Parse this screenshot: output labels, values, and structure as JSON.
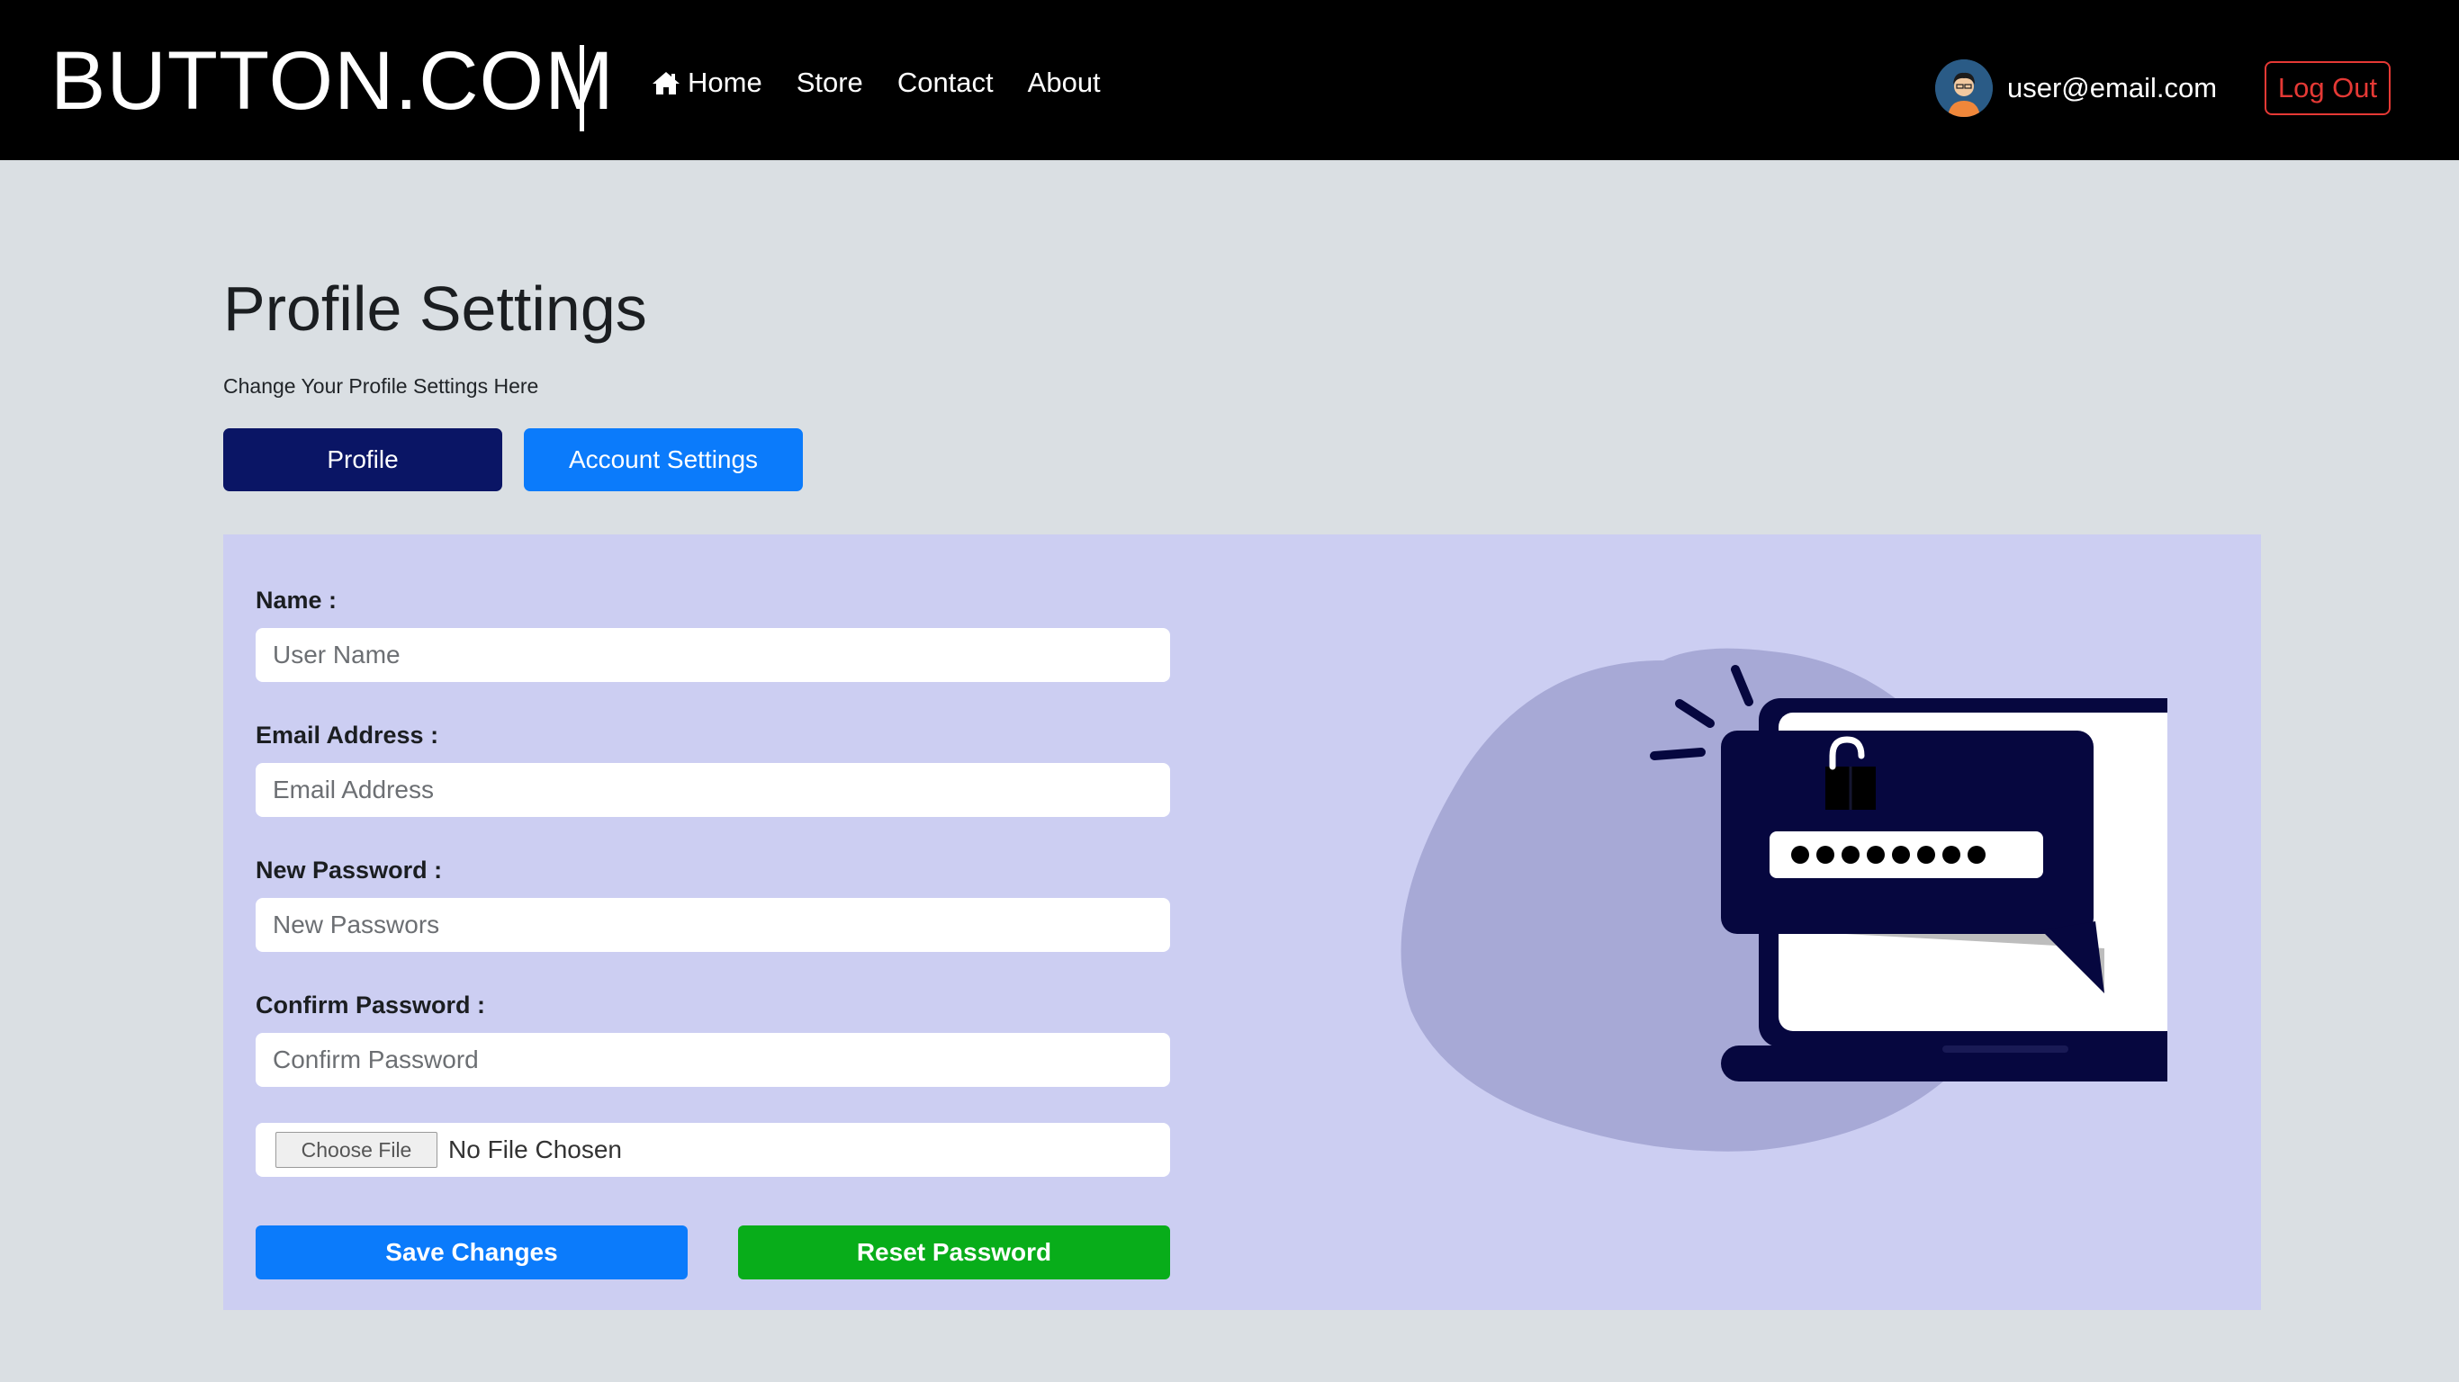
{
  "header": {
    "brand": "BUTTON.COM",
    "nav": [
      {
        "label": "Home",
        "icon": "home-icon"
      },
      {
        "label": "Store"
      },
      {
        "label": "Contact"
      },
      {
        "label": "About"
      }
    ],
    "user_email": "user@email.com",
    "logout_label": "Log Out"
  },
  "page": {
    "title": "Profile Settings",
    "subtitle": "Change Your Profile Settings Here",
    "tabs": [
      {
        "label": "Profile",
        "active": true
      },
      {
        "label": "Account Settings",
        "active": false
      }
    ]
  },
  "form": {
    "name": {
      "label": "Name :",
      "placeholder": "User Name",
      "value": ""
    },
    "email": {
      "label": "Email Address :",
      "placeholder": "Email Address",
      "value": ""
    },
    "new_password": {
      "label": "New Password :",
      "placeholder": "New Passwors",
      "value": ""
    },
    "confirm_password": {
      "label": "Confirm Password :",
      "placeholder": "Confirm Password",
      "value": ""
    },
    "file": {
      "button_label": "Choose File",
      "status": "No File Chosen"
    },
    "save_label": "Save Changes",
    "reset_label": "Reset Password"
  },
  "illustration": {
    "icon": "password-laptop-illustration",
    "masked_password": "●●●●●●●●"
  },
  "colors": {
    "header_bg": "#000000",
    "page_bg": "#dadfe3",
    "panel_bg": "#cccef2",
    "tab_active": "#0a1565",
    "tab_inactive": "#0b7bfb",
    "save_btn": "#0b7bfb",
    "reset_btn": "#08ad1a",
    "logout": "#e53935",
    "illustration_navy": "#06073f",
    "illustration_blob": "#a7a9d6"
  }
}
